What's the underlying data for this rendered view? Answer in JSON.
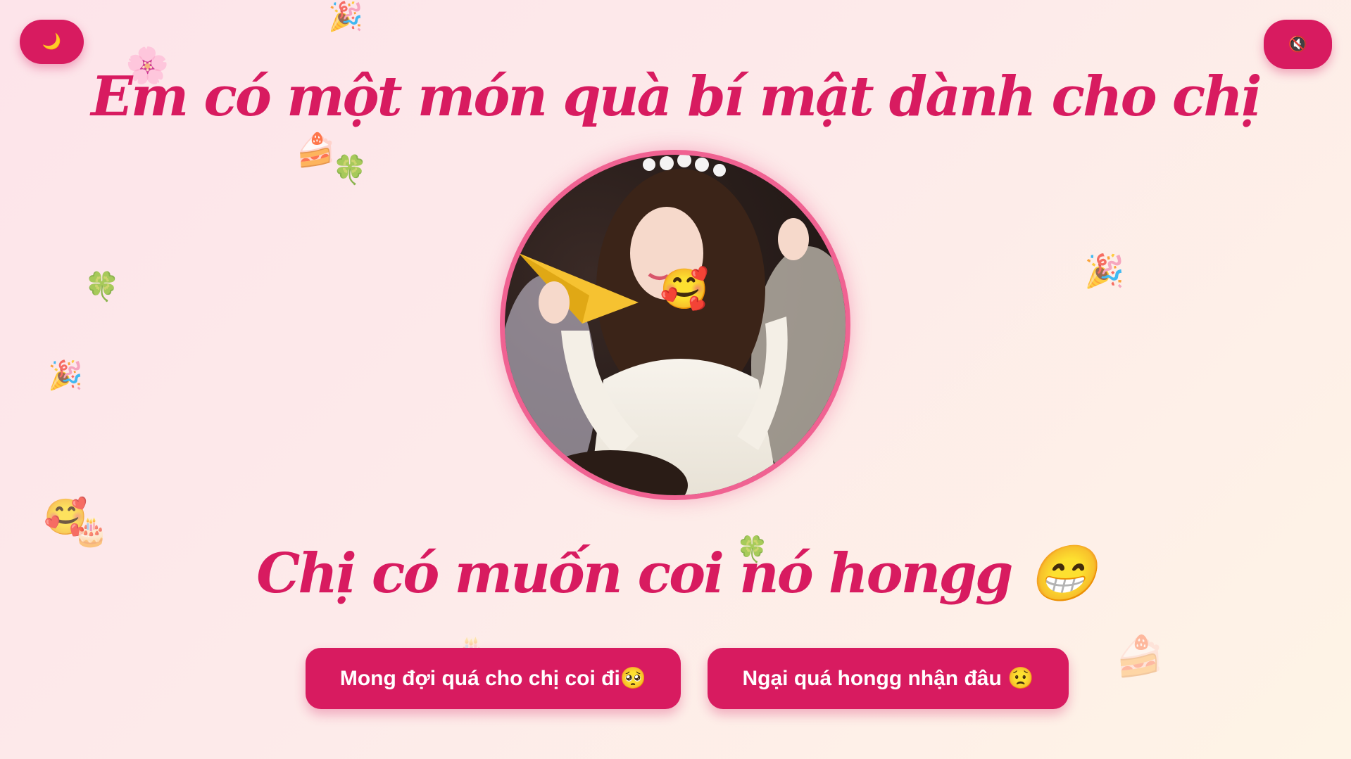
{
  "controls": {
    "theme_icon": "🌙",
    "sound_icon": "🔇"
  },
  "main": {
    "title": "Em có một món quà bí mật dành cho chị",
    "question": "Chị có muốn coi nó hongg 😁"
  },
  "buttons": {
    "yes_label": "Mong đợi quá cho chị coi đi🥺",
    "no_label": "Ngại quá hongg nhận đâu 😟"
  },
  "decorations": {
    "party_popper": "🎉",
    "cherry_blossom": "🌸",
    "cake": "🍰",
    "clover": "🍀",
    "smiling_hearts": "🥰",
    "birthday_cake": "🎂"
  },
  "colors": {
    "accent": "#d81b60",
    "frame": "#f06292"
  }
}
